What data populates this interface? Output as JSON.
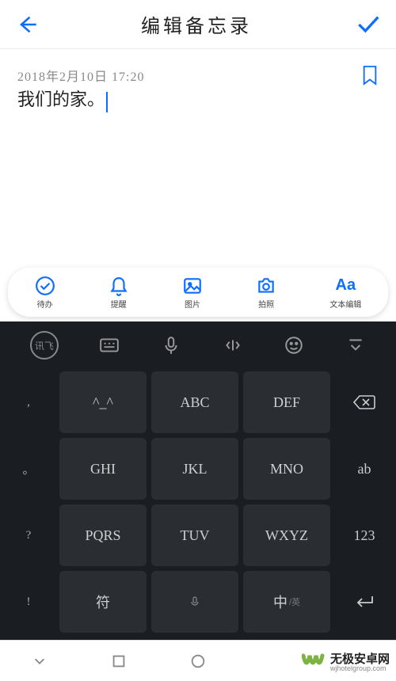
{
  "header": {
    "title": "编辑备忘录"
  },
  "note": {
    "timestamp": "2018年2月10日  17:20",
    "text": "我们的家。"
  },
  "toolbar": {
    "items": [
      {
        "label": "待办"
      },
      {
        "label": "提醒"
      },
      {
        "label": "图片"
      },
      {
        "label": "拍照"
      },
      {
        "label": "文本编辑",
        "icon_text": "Aa"
      }
    ]
  },
  "keyboard": {
    "left_col": [
      ",",
      "。",
      "?",
      "!"
    ],
    "rows": [
      [
        "^_^",
        "ABC",
        "DEF"
      ],
      [
        "GHI",
        "JKL",
        "MNO"
      ],
      [
        "PQRS",
        "TUV",
        "WXYZ"
      ]
    ],
    "right_col": [
      "",
      "ab",
      "123",
      ""
    ],
    "bottom": {
      "sym": "符",
      "lang_main": "中",
      "lang_sub": "/英"
    }
  },
  "watermark": {
    "cn": "无极安卓网",
    "en": "wjhotelgroup.com"
  }
}
